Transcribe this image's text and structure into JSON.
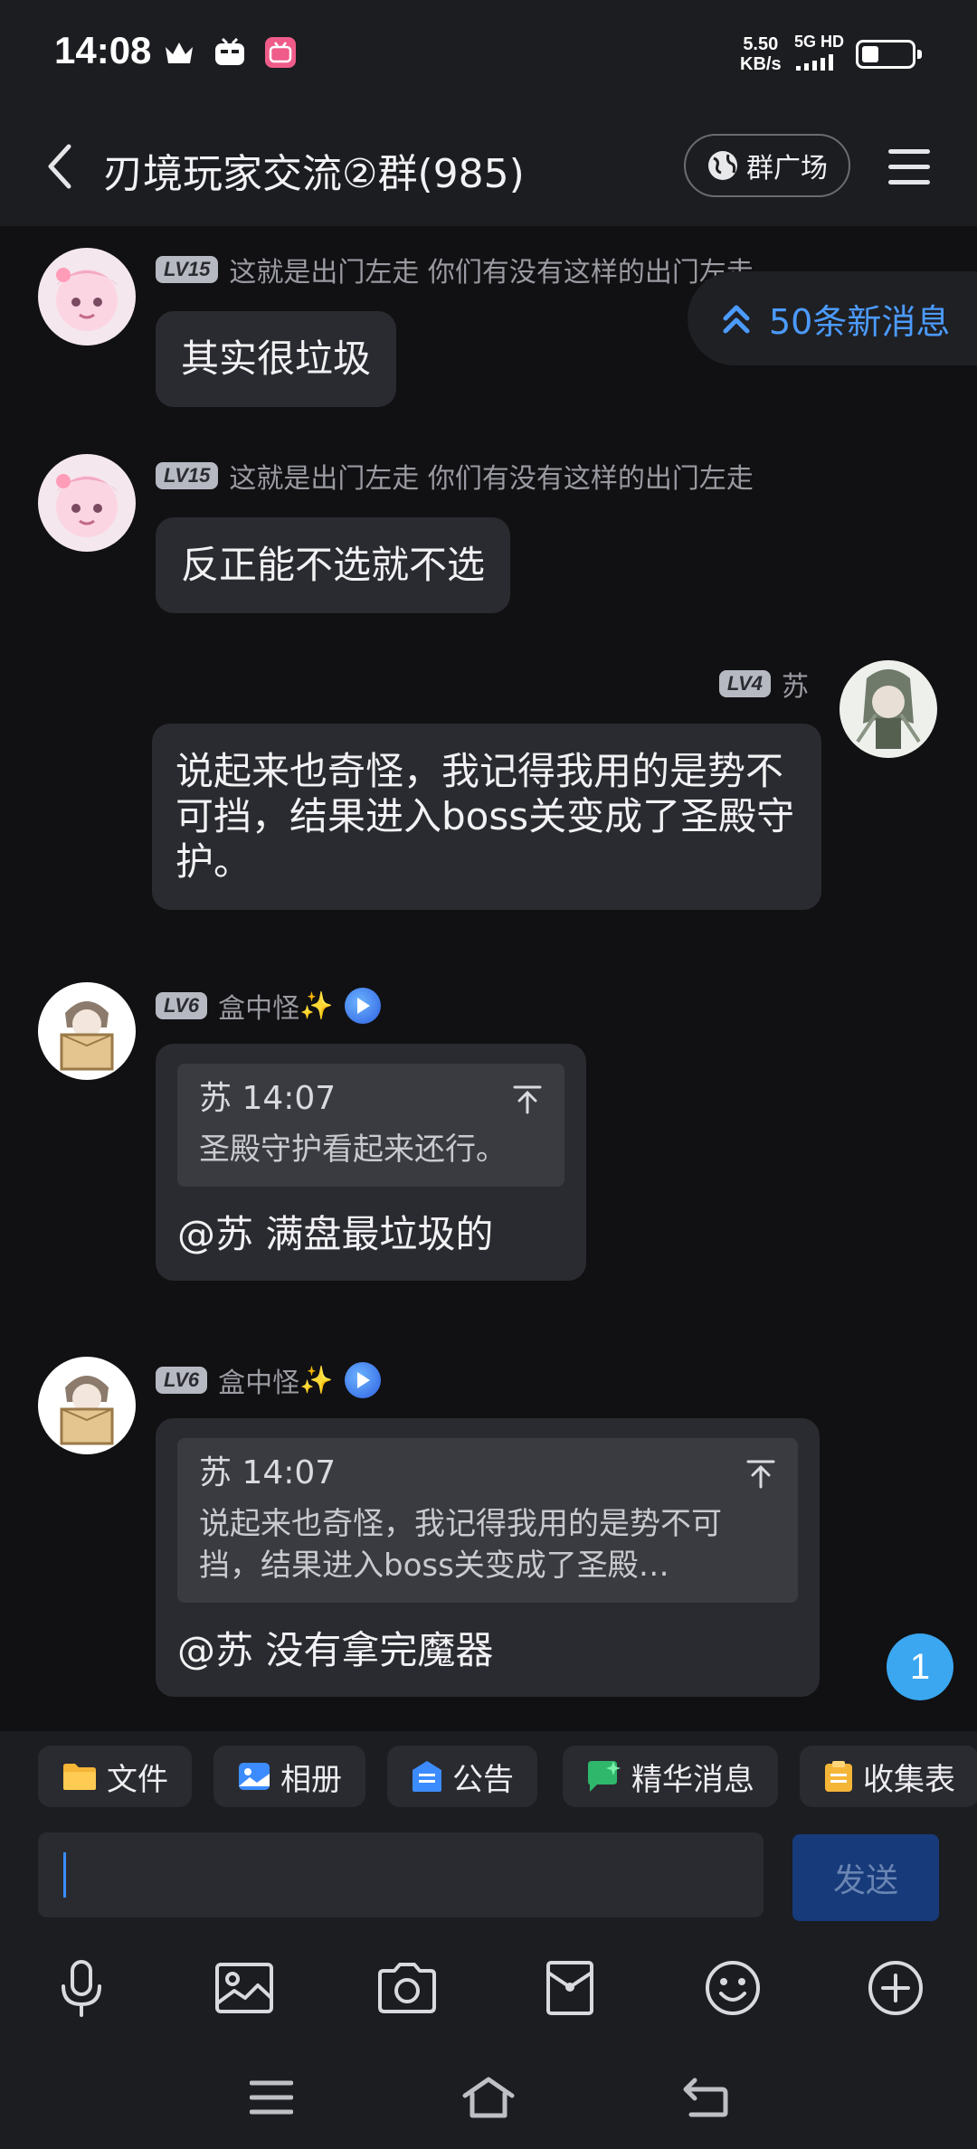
{
  "status": {
    "time": "14:08",
    "net_speed_value": "5.50",
    "net_speed_unit": "KB/s",
    "network": "5G HD",
    "battery_level": 0.35
  },
  "header": {
    "title": "刃境玩家交流②群(985)",
    "square_label": "群广场"
  },
  "new_messages": "50条新消息",
  "messages": [
    {
      "level": "LV15",
      "name": "这就是出门左走 你们有没有这样的出门左走",
      "text": "其实很垃圾"
    },
    {
      "level": "LV15",
      "name": "这就是出门左走 你们有没有这样的出门左走",
      "text": "反正能不选就不选"
    },
    {
      "level": "LV4",
      "name": "苏",
      "text": "说起来也奇怪，我记得我用的是势不可挡，结果进入boss关变成了圣殿守护。"
    },
    {
      "level": "LV6",
      "name": "盒中怪",
      "name_emoji": "✨",
      "quote_head": "苏 14:07",
      "quote_body": "圣殿守护看起来还行。",
      "text": "@苏 满盘最垃圾的"
    },
    {
      "level": "LV6",
      "name": "盒中怪",
      "name_emoji": "✨",
      "quote_head": "苏 14:07",
      "quote_body": "说起来也奇怪，我记得我用的是势不可挡，结果进入boss关变成了圣殿…",
      "text": "@苏 没有拿完魔器"
    }
  ],
  "unread_count": "1",
  "toolbar": {
    "chips": [
      "文件",
      "相册",
      "公告",
      "精华消息",
      "收集表"
    ]
  },
  "input": {
    "value": ""
  },
  "send_label": "发送",
  "colors": {
    "accent": "#4c9bff",
    "bubble": "#2a2b30",
    "send_bg": "#173a7a",
    "unread": "#3aa7f0"
  }
}
